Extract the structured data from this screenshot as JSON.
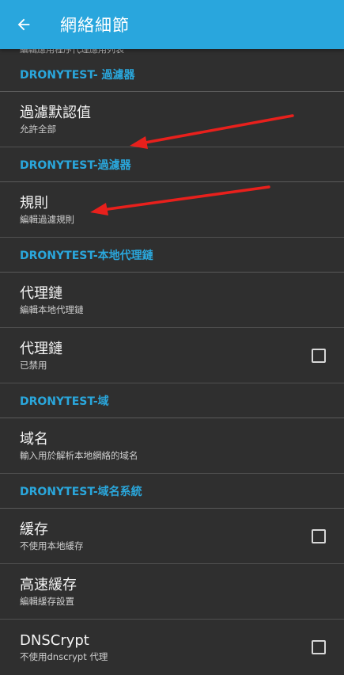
{
  "appbar": {
    "title": "網絡細節",
    "back_icon": "arrow-back-icon"
  },
  "clipped_text": "編輯應用程序代理應用列表",
  "colors": {
    "accent": "#29a6dd",
    "background": "#2f2f2f",
    "arrow": "#e8201c"
  },
  "sections": [
    {
      "header": "DRONYTEST- 過濾器",
      "items": [
        {
          "title": "過濾默認值",
          "subtitle": "允許全部"
        }
      ]
    },
    {
      "header": "DRONYTEST-過濾器",
      "items": [
        {
          "title": "規則",
          "subtitle": "編輯過濾規則"
        }
      ]
    },
    {
      "header": "DRONYTEST-本地代理鏈",
      "items": [
        {
          "title": "代理鏈",
          "subtitle": "編輯本地代理鏈"
        },
        {
          "title": "代理鏈",
          "subtitle": "已禁用",
          "checkbox": false
        }
      ]
    },
    {
      "header": "DRONYTEST-域",
      "items": [
        {
          "title": "域名",
          "subtitle": "輸入用於解析本地網絡的域名"
        }
      ]
    },
    {
      "header": "DRONYTEST-域名系統",
      "items": [
        {
          "title": "緩存",
          "subtitle": "不使用本地緩存",
          "checkbox": false
        },
        {
          "title": "高速緩存",
          "subtitle": "編輯緩存設置"
        },
        {
          "title": "DNSCrypt",
          "subtitle": "不使用dnscrypt 代理",
          "checkbox": false
        }
      ]
    }
  ]
}
